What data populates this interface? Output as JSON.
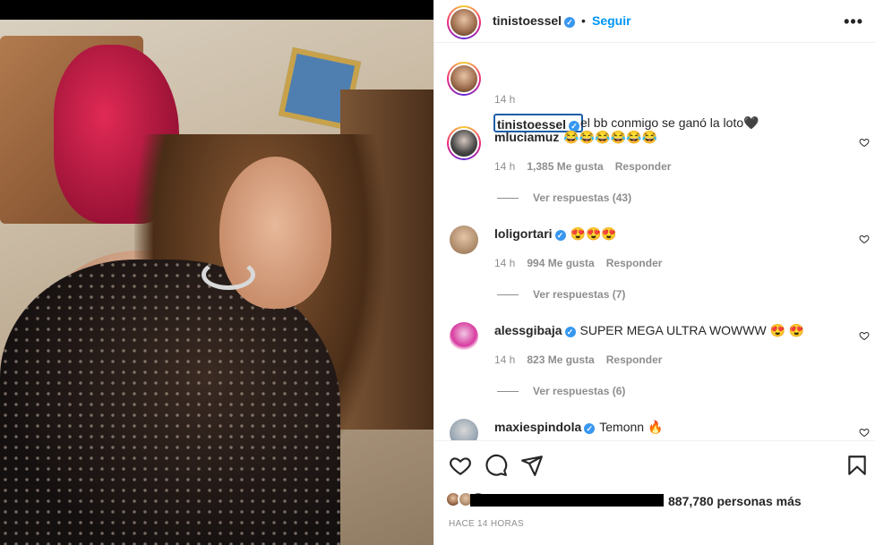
{
  "post": {
    "username": "tinistoessel",
    "follow_label": "Seguir",
    "dot": "•",
    "caption": "el bb conmigo se ganó la loto🖤",
    "caption_time": "14 h"
  },
  "comments": [
    {
      "username": "mluciamuz",
      "verified": false,
      "text": "😂😂😂😂😂😂",
      "time": "14 h",
      "likes": "1,385 Me gusta",
      "reply": "Responder",
      "view_replies": "Ver respuestas (43)"
    },
    {
      "username": "loligortari",
      "verified": true,
      "text": "😍😍😍",
      "time": "14 h",
      "likes": "994 Me gusta",
      "reply": "Responder",
      "view_replies": "Ver respuestas (7)"
    },
    {
      "username": "alessgibaja",
      "verified": true,
      "text": "SUPER MEGA ULTRA WOWWW 😍 😍",
      "time": "14 h",
      "likes": "823 Me gusta",
      "reply": "Responder",
      "view_replies": "Ver respuestas (6)"
    },
    {
      "username": "maxiespindola",
      "verified": true,
      "text": "Temonn 🔥",
      "time": "",
      "likes": "",
      "reply": "",
      "view_replies": ""
    }
  ],
  "likes_summary": "887,780 personas más",
  "posted_ago": "HACE 14 HORAS",
  "icons": {
    "like": "heart-icon",
    "comment": "comment-icon",
    "share": "send-icon",
    "save": "bookmark-icon",
    "more": "more-options-icon",
    "verified": "verified-badge-icon"
  },
  "colors": {
    "accent": "#0095f6",
    "verified": "#3897f0",
    "muted": "#8e8e8e"
  }
}
